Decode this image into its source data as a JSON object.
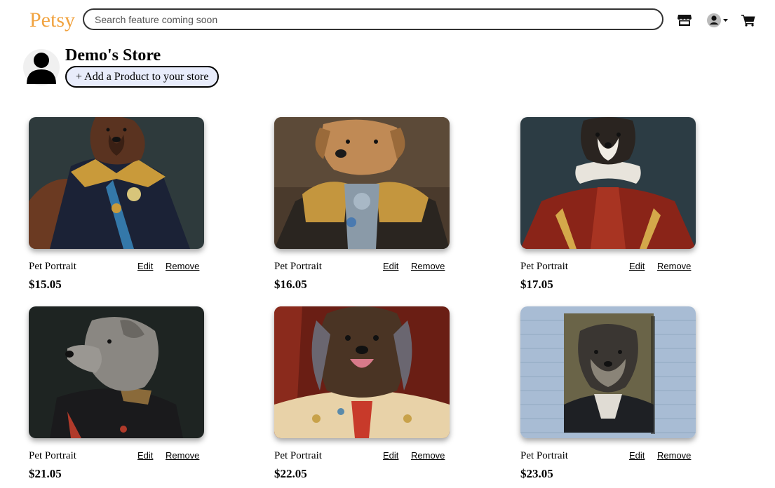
{
  "header": {
    "logo": "Petsy",
    "search_placeholder": "Search feature coming soon",
    "icons": [
      "store-icon",
      "user-icon",
      "caret-down-icon",
      "cart-icon"
    ]
  },
  "store": {
    "title": "Demo's Store",
    "add_button_label": "+ Add a Product to your store"
  },
  "products": [
    {
      "name": "Pet Portrait",
      "price": "$15.05",
      "edit_label": "Edit",
      "remove_label": "Remove",
      "bg": "#2e3a3c",
      "fur": "#5a3320",
      "coat": "#1b2236",
      "accent": "#c99a3a"
    },
    {
      "name": "Pet Portrait",
      "price": "$16.05",
      "edit_label": "Edit",
      "remove_label": "Remove",
      "bg": "#4a3a2c",
      "fur": "#c08a55",
      "coat": "#2a2520",
      "accent": "#c4963e"
    },
    {
      "name": "Pet Portrait",
      "price": "$17.05",
      "edit_label": "Edit",
      "remove_label": "Remove",
      "bg": "#2c3c44",
      "fur": "#2a2420",
      "coat": "#8a2418",
      "accent": "#e8e4dc"
    },
    {
      "name": "Pet Portrait",
      "price": "$21.05",
      "edit_label": "Edit",
      "remove_label": "Remove",
      "bg": "#1e2422",
      "fur": "#8a8782",
      "coat": "#1a1a1c",
      "accent": "#b03a2a"
    },
    {
      "name": "Pet Portrait",
      "price": "$22.05",
      "edit_label": "Edit",
      "remove_label": "Remove",
      "bg": "#6a1e14",
      "fur": "#4a3424",
      "coat": "#e8d2a8",
      "accent": "#c8a24a"
    },
    {
      "name": "Pet Portrait",
      "price": "$23.05",
      "edit_label": "Edit",
      "remove_label": "Remove",
      "bg": "#a8bcd4",
      "fur": "#3a3632",
      "coat": "#1e2024",
      "accent": "#6a6448"
    }
  ],
  "colors": {
    "logo": "#f1a340",
    "add_button_bg": "#e8ecfb"
  }
}
